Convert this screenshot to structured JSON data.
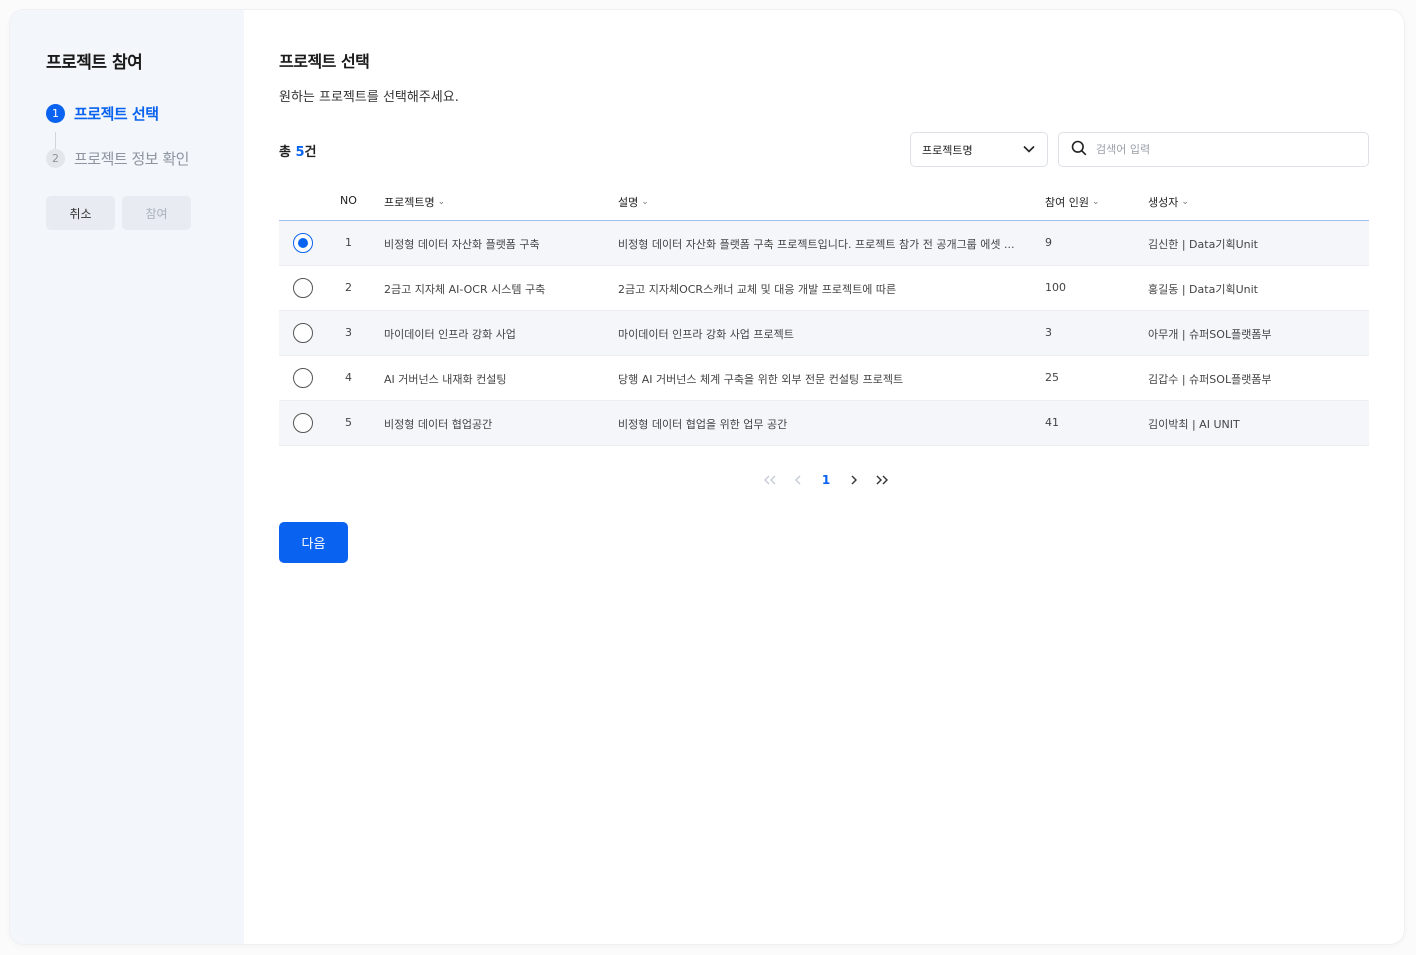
{
  "sidebar": {
    "title": "프로젝트 참여",
    "steps": [
      {
        "num": "1",
        "label": "프로젝트 선택",
        "active": true
      },
      {
        "num": "2",
        "label": "프로젝트 정보 확인",
        "active": false
      }
    ],
    "cancel_label": "취소",
    "join_label": "참여"
  },
  "main": {
    "title": "프로젝트 선택",
    "description": "원하는 프로젝트를 선택해주세요.",
    "total_prefix": "총 ",
    "total_count": "5",
    "total_suffix": "건",
    "filter_select": {
      "selected": "프로젝트명"
    },
    "search": {
      "placeholder": "검색어 입력"
    },
    "table": {
      "headers": {
        "no": "NO",
        "name": "프로젝트명",
        "desc": "설명",
        "members": "참여 인원",
        "creator": "생성자"
      },
      "rows": [
        {
          "no": "1",
          "name": "비정형 데이터 자산화 플랫폼 구축",
          "desc": "비정형 데이터 자산화 플랫폼 구축 프로젝트입니다. 프로젝트 참가 전 공개그룹 에셋 ...",
          "members": "9",
          "creator": "김신한 | Data기획Unit",
          "selected": true
        },
        {
          "no": "2",
          "name": "2금고 지자체 AI-OCR 시스템 구축",
          "desc": "2금고 지자체OCR스캐너 교체 및 대응 개발 프로젝트에 따른",
          "members": "100",
          "creator": "홍길동 | Data기획Unit",
          "selected": false
        },
        {
          "no": "3",
          "name": "마이데이터 인프라 강화 사업",
          "desc": "마이데이터 인프라 강화 사업 프로젝트",
          "members": "3",
          "creator": "아무개 | 슈퍼SOL플랫폼부",
          "selected": false
        },
        {
          "no": "4",
          "name": "AI 거버넌스 내재화 컨설팅",
          "desc": "당행 AI 거버넌스 체계 구축을 위한 외부 전문 컨설팅 프로젝트",
          "members": "25",
          "creator": "김갑수 | 슈퍼SOL플랫폼부",
          "selected": false
        },
        {
          "no": "5",
          "name": "비정형 데이터 협업공간",
          "desc": "비정형 데이터 협업을 위한 업무 공간",
          "members": "41",
          "creator": "김이박최 | AI UNIT",
          "selected": false
        }
      ]
    },
    "pagination": {
      "current": "1"
    },
    "next_label": "다음"
  },
  "colors": {
    "accent": "#0a63f0",
    "sidebar_bg": "#f3f6fa"
  }
}
